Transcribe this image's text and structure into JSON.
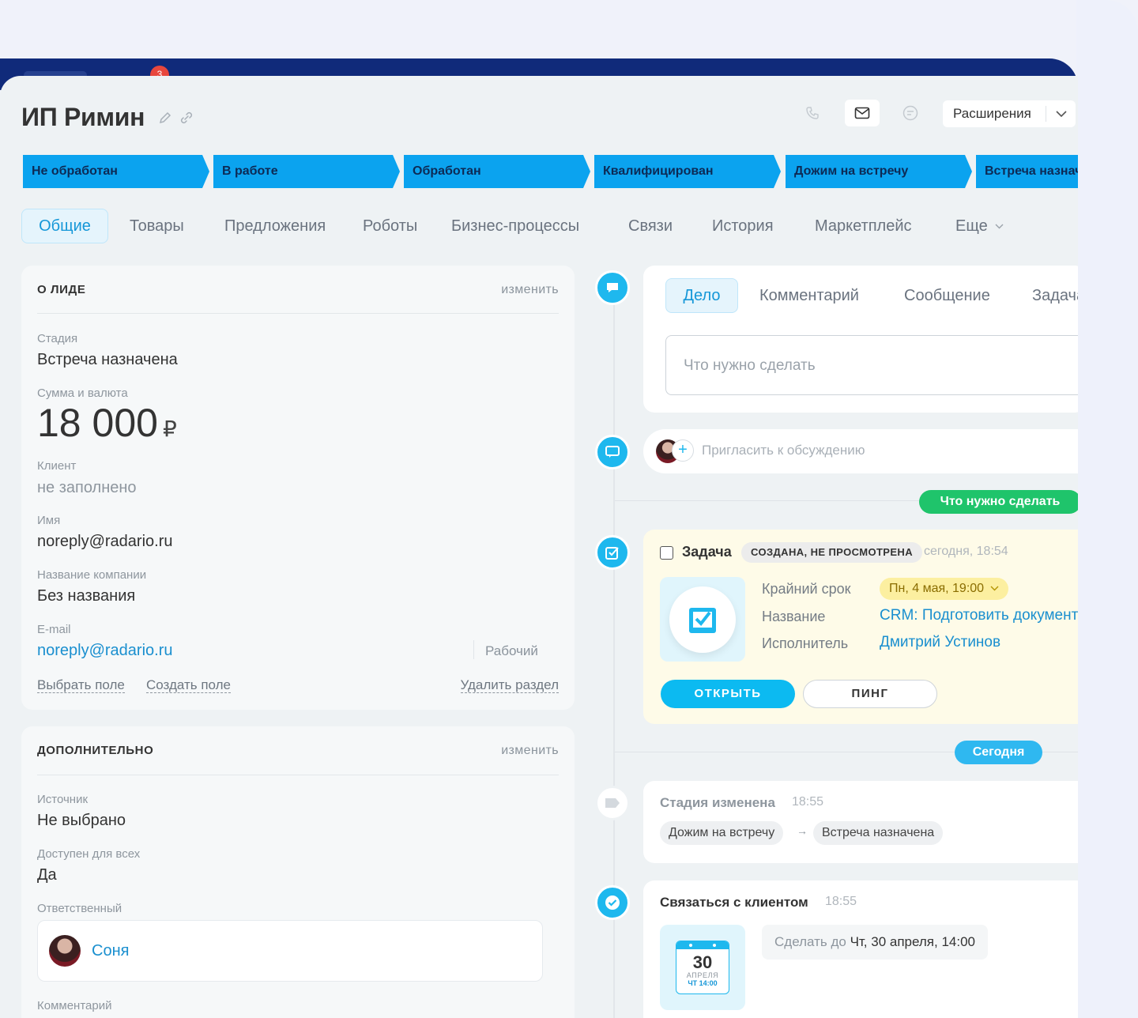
{
  "topbar": {
    "badge": "3"
  },
  "header": {
    "title": "ИП Римин",
    "extensions_label": "Расширения"
  },
  "stages": [
    "Не обработан",
    "В работе",
    "Обработан",
    "Квалифицирован",
    "Дожим на встречу",
    "Встреча назначена"
  ],
  "tabs": [
    "Общие",
    "Товары",
    "Предложения",
    "Роботы",
    "Бизнес-процессы",
    "Связи",
    "История",
    "Маркетплейс",
    "Еще"
  ],
  "about": {
    "heading": "О ЛИДЕ",
    "edit": "изменить",
    "stage_label": "Стадия",
    "stage_value": "Встреча назначена",
    "sum_label": "Сумма и валюта",
    "sum_value": "18 000",
    "currency": "₽",
    "client_label": "Клиент",
    "client_value": "не заполнено",
    "name_label": "Имя",
    "name_value": "noreply@radario.ru",
    "company_label": "Название компании",
    "company_value": "Без названия",
    "email_label": "E-mail",
    "email_value": "noreply@radario.ru",
    "email_type": "Рабочий",
    "select_field": "Выбрать поле",
    "create_field": "Создать поле",
    "delete_section": "Удалить раздел"
  },
  "extra": {
    "heading": "ДОПОЛНИТЕЛЬНО",
    "edit": "изменить",
    "source_label": "Источник",
    "source_value": "Не выбрано",
    "available_label": "Доступен для всех",
    "available_value": "Да",
    "responsible_label": "Ответственный",
    "responsible_value": "Соня",
    "comment_label": "Комментарий"
  },
  "composer": {
    "tabs": [
      "Дело",
      "Комментарий",
      "Сообщение",
      "Задача"
    ],
    "placeholder": "Что нужно сделать"
  },
  "invite": {
    "placeholder": "Пригласить к обсуждению"
  },
  "todo_pill": "Что нужно сделать",
  "task": {
    "title": "Задача",
    "status": "СОЗДАНА, НЕ ПРОСМОТРЕНА",
    "time": "сегодня, 18:54",
    "deadline_label": "Крайний срок",
    "deadline_value": "Пн, 4 мая, 19:00",
    "name_label": "Название",
    "name_value": "CRM: Подготовить документы",
    "assignee_label": "Исполнитель",
    "assignee_value": "Дмитрий Устинов",
    "open": "ОТКРЫТЬ",
    "ping": "ПИНГ"
  },
  "today_pill": "Сегодня",
  "stage_change": {
    "title": "Стадия изменена",
    "time": "18:55",
    "from": "Дожим на встречу",
    "arrow": "→",
    "to": "Встреча назначена"
  },
  "contact": {
    "title": "Связаться с клиентом",
    "time": "18:55",
    "cal_day": "30",
    "cal_month": "АПРЕЛЯ",
    "cal_time": "ЧТ 14:00",
    "due_prefix": "Сделать до",
    "due_value": "Чт, 30 апреля, 14:00"
  },
  "colors": {
    "stage": "#0ba3ef",
    "accent": "#1597d8",
    "green": "#1fc46b",
    "today": "#2fb8f0"
  }
}
